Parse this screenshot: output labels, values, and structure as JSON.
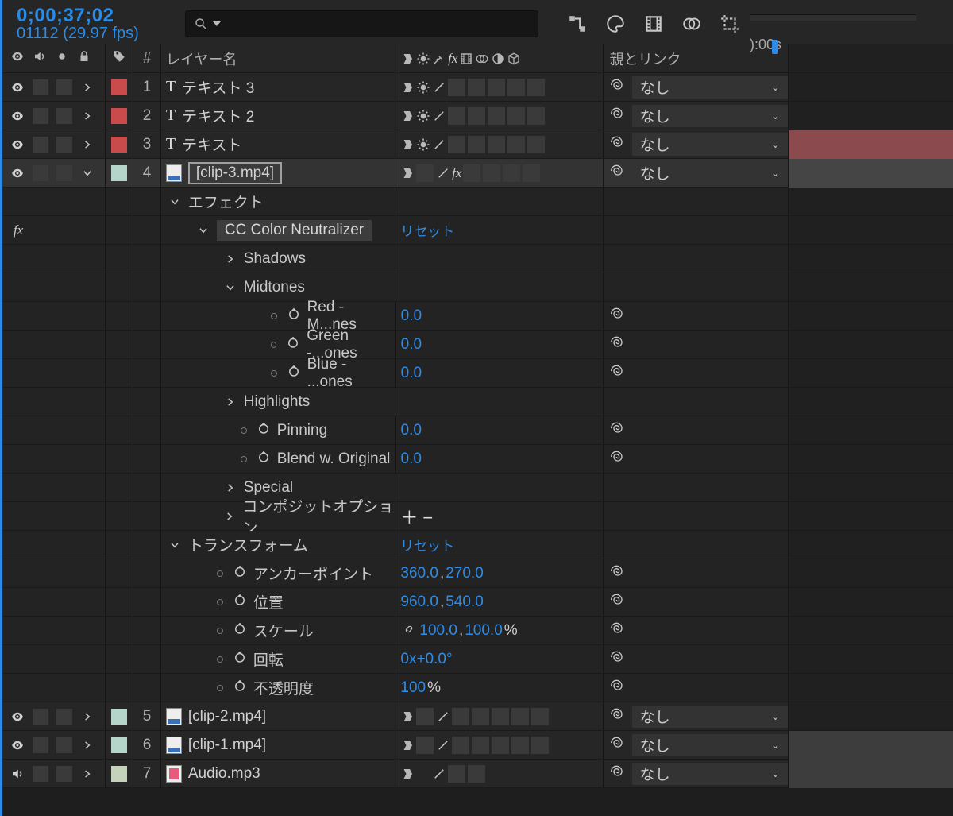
{
  "timecode": "0;00;37;02",
  "frames_fps": "01112 (29.97 fps)",
  "time_ruler_start": "):00s",
  "columns": {
    "layer_name": "レイヤー名",
    "parent_link": "親とリンク",
    "num": "#"
  },
  "parent_none": "なし",
  "layers": [
    {
      "idx": "1",
      "name": "テキスト 3",
      "type": "text",
      "color": "red"
    },
    {
      "idx": "2",
      "name": "テキスト 2",
      "type": "text",
      "color": "red"
    },
    {
      "idx": "3",
      "name": "テキスト",
      "type": "text",
      "color": "red"
    },
    {
      "idx": "4",
      "name": "[clip-3.mp4]",
      "type": "mov",
      "color": "mint",
      "expanded": true
    },
    {
      "idx": "5",
      "name": "[clip-2.mp4]",
      "type": "mov",
      "color": "mint"
    },
    {
      "idx": "6",
      "name": "[clip-1.mp4]",
      "type": "mov",
      "color": "mint"
    },
    {
      "idx": "7",
      "name": "Audio.mp3",
      "type": "mp3",
      "color": "sage"
    }
  ],
  "groups": {
    "effects": "エフェクト",
    "transform": "トランスフォーム",
    "reset": "リセット",
    "composite_options": "コンポジットオプション"
  },
  "effect": {
    "name": "CC Color Neutralizer",
    "sections": {
      "shadows": "Shadows",
      "midtones": "Midtones",
      "highlights": "Highlights",
      "special": "Special"
    },
    "midtones": {
      "red": {
        "label": "Red - M...nes",
        "value": "0.0"
      },
      "green": {
        "label": "Green -...ones",
        "value": "0.0"
      },
      "blue": {
        "label": "Blue - ...ones",
        "value": "0.0"
      }
    },
    "pinning": {
      "label": "Pinning",
      "value": "0.0"
    },
    "blend": {
      "label": "Blend w. Original",
      "value": "0.0"
    }
  },
  "transform": {
    "anchor": {
      "label": "アンカーポイント",
      "x": "360.0",
      "y": "270.0"
    },
    "position": {
      "label": "位置",
      "x": "960.0",
      "y": "540.0"
    },
    "scale": {
      "label": "スケール",
      "x": "100.0",
      "y": "100.0",
      "unit": "%"
    },
    "rotation": {
      "label": "回転",
      "value": "0x+0.0°"
    },
    "opacity": {
      "label": "不透明度",
      "value": "100",
      "unit": "%"
    }
  }
}
